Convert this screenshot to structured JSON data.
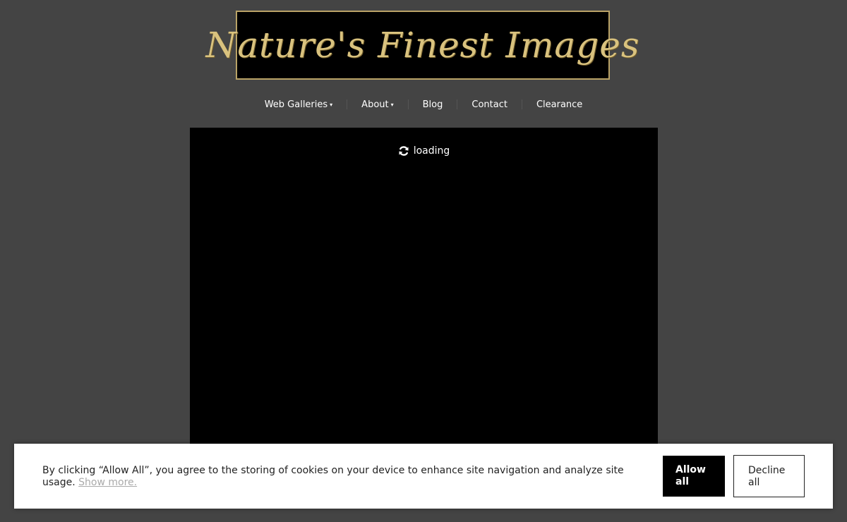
{
  "logo": {
    "text": "Nature's Finest Images",
    "color": "#d9c27e",
    "border_color": "#b9a266"
  },
  "nav": {
    "items": [
      {
        "label": "Web Galleries",
        "has_dropdown": true
      },
      {
        "label": "About",
        "has_dropdown": true
      },
      {
        "label": "Blog",
        "has_dropdown": false
      },
      {
        "label": "Contact",
        "has_dropdown": false
      },
      {
        "label": "Clearance",
        "has_dropdown": false
      }
    ],
    "dropdown_glyph": "▾"
  },
  "viewer": {
    "loading_text": "loading",
    "icon": "refresh-icon"
  },
  "cookie": {
    "message": "By clicking “Allow All”, you agree to the storing of cookies on your device to enhance site navigation and analyze site usage.",
    "show_more": "Show more.",
    "allow_label": "Allow all",
    "decline_label": "Decline all"
  },
  "colors": {
    "background": "#444444",
    "viewer": "#000000",
    "cookie_bar": "#ffffff"
  }
}
